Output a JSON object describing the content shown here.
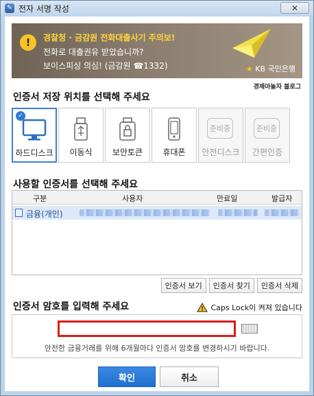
{
  "window": {
    "title": "전자 서명 작성",
    "close_label": "✕"
  },
  "banner": {
    "line1": "경찰청 · 금감원 전화대출사기 주의보!",
    "line2": "전화로 대출권유 받았습니까?",
    "line3": "보이스피싱 의심! (금감원 ☎1332)",
    "brand": "KB 국민은행",
    "tag": "경제아놀자 블로그"
  },
  "storage": {
    "heading": "인증서 저장 위치를 선택해 주세요",
    "items": [
      {
        "label": "하드디스크",
        "icon": "monitor-icon",
        "selected": true,
        "disabled": false
      },
      {
        "label": "이동식",
        "icon": "usb-icon",
        "selected": false,
        "disabled": false
      },
      {
        "label": "보안토큰",
        "icon": "token-icon",
        "selected": false,
        "disabled": false
      },
      {
        "label": "휴대폰",
        "icon": "phone-icon",
        "selected": false,
        "disabled": false
      },
      {
        "label": "안전디스크",
        "icon": "coming-soon-icon",
        "badge": "준비중",
        "selected": false,
        "disabled": true
      },
      {
        "label": "간편인증",
        "icon": "coming-soon-icon",
        "badge": "준비중",
        "selected": false,
        "disabled": true
      }
    ]
  },
  "certs": {
    "heading": "사용할 인증서를 선택해 주세요",
    "columns": [
      "구분",
      "사용자",
      "만료일",
      "발급자"
    ],
    "rows": [
      {
        "type": "금융(개인)"
      }
    ],
    "buttons": [
      "인증서 보기",
      "인증서 찾기",
      "인증서 삭제"
    ]
  },
  "password": {
    "heading": "인증서 암호를 입력해 주세요",
    "caps_warning": "Caps Lock이 켜져 있습니다",
    "value": "",
    "note": "안전한 금융거래를 위해 6개월마다 인증서 암호를 변경하시기 바랍니다."
  },
  "actions": {
    "confirm": "확인",
    "cancel": "취소"
  },
  "colors": {
    "accent": "#2170cf",
    "highlight": "#e01a1a",
    "warning": "#f7c326"
  }
}
